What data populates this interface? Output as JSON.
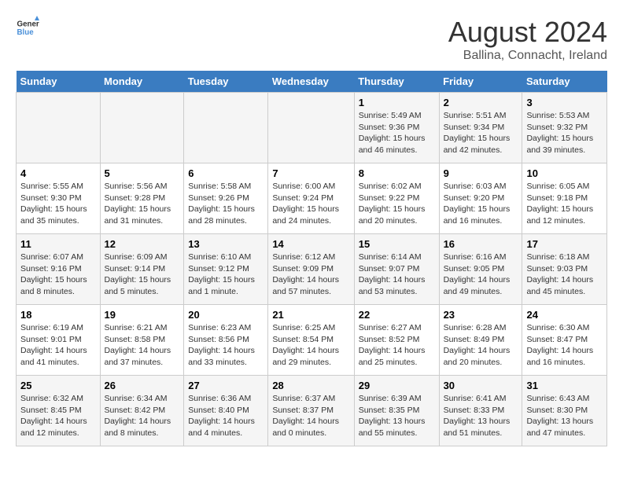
{
  "header": {
    "logo_general": "General",
    "logo_blue": "Blue",
    "title": "August 2024",
    "subtitle": "Ballina, Connacht, Ireland"
  },
  "calendar": {
    "days_of_week": [
      "Sunday",
      "Monday",
      "Tuesday",
      "Wednesday",
      "Thursday",
      "Friday",
      "Saturday"
    ],
    "weeks": [
      {
        "days": [
          {
            "number": "",
            "info": ""
          },
          {
            "number": "",
            "info": ""
          },
          {
            "number": "",
            "info": ""
          },
          {
            "number": "",
            "info": ""
          },
          {
            "number": "1",
            "info": "Sunrise: 5:49 AM\nSunset: 9:36 PM\nDaylight: 15 hours\nand 46 minutes."
          },
          {
            "number": "2",
            "info": "Sunrise: 5:51 AM\nSunset: 9:34 PM\nDaylight: 15 hours\nand 42 minutes."
          },
          {
            "number": "3",
            "info": "Sunrise: 5:53 AM\nSunset: 9:32 PM\nDaylight: 15 hours\nand 39 minutes."
          }
        ]
      },
      {
        "days": [
          {
            "number": "4",
            "info": "Sunrise: 5:55 AM\nSunset: 9:30 PM\nDaylight: 15 hours\nand 35 minutes."
          },
          {
            "number": "5",
            "info": "Sunrise: 5:56 AM\nSunset: 9:28 PM\nDaylight: 15 hours\nand 31 minutes."
          },
          {
            "number": "6",
            "info": "Sunrise: 5:58 AM\nSunset: 9:26 PM\nDaylight: 15 hours\nand 28 minutes."
          },
          {
            "number": "7",
            "info": "Sunrise: 6:00 AM\nSunset: 9:24 PM\nDaylight: 15 hours\nand 24 minutes."
          },
          {
            "number": "8",
            "info": "Sunrise: 6:02 AM\nSunset: 9:22 PM\nDaylight: 15 hours\nand 20 minutes."
          },
          {
            "number": "9",
            "info": "Sunrise: 6:03 AM\nSunset: 9:20 PM\nDaylight: 15 hours\nand 16 minutes."
          },
          {
            "number": "10",
            "info": "Sunrise: 6:05 AM\nSunset: 9:18 PM\nDaylight: 15 hours\nand 12 minutes."
          }
        ]
      },
      {
        "days": [
          {
            "number": "11",
            "info": "Sunrise: 6:07 AM\nSunset: 9:16 PM\nDaylight: 15 hours\nand 8 minutes."
          },
          {
            "number": "12",
            "info": "Sunrise: 6:09 AM\nSunset: 9:14 PM\nDaylight: 15 hours\nand 5 minutes."
          },
          {
            "number": "13",
            "info": "Sunrise: 6:10 AM\nSunset: 9:12 PM\nDaylight: 15 hours\nand 1 minute."
          },
          {
            "number": "14",
            "info": "Sunrise: 6:12 AM\nSunset: 9:09 PM\nDaylight: 14 hours\nand 57 minutes."
          },
          {
            "number": "15",
            "info": "Sunrise: 6:14 AM\nSunset: 9:07 PM\nDaylight: 14 hours\nand 53 minutes."
          },
          {
            "number": "16",
            "info": "Sunrise: 6:16 AM\nSunset: 9:05 PM\nDaylight: 14 hours\nand 49 minutes."
          },
          {
            "number": "17",
            "info": "Sunrise: 6:18 AM\nSunset: 9:03 PM\nDaylight: 14 hours\nand 45 minutes."
          }
        ]
      },
      {
        "days": [
          {
            "number": "18",
            "info": "Sunrise: 6:19 AM\nSunset: 9:01 PM\nDaylight: 14 hours\nand 41 minutes."
          },
          {
            "number": "19",
            "info": "Sunrise: 6:21 AM\nSunset: 8:58 PM\nDaylight: 14 hours\nand 37 minutes."
          },
          {
            "number": "20",
            "info": "Sunrise: 6:23 AM\nSunset: 8:56 PM\nDaylight: 14 hours\nand 33 minutes."
          },
          {
            "number": "21",
            "info": "Sunrise: 6:25 AM\nSunset: 8:54 PM\nDaylight: 14 hours\nand 29 minutes."
          },
          {
            "number": "22",
            "info": "Sunrise: 6:27 AM\nSunset: 8:52 PM\nDaylight: 14 hours\nand 25 minutes."
          },
          {
            "number": "23",
            "info": "Sunrise: 6:28 AM\nSunset: 8:49 PM\nDaylight: 14 hours\nand 20 minutes."
          },
          {
            "number": "24",
            "info": "Sunrise: 6:30 AM\nSunset: 8:47 PM\nDaylight: 14 hours\nand 16 minutes."
          }
        ]
      },
      {
        "days": [
          {
            "number": "25",
            "info": "Sunrise: 6:32 AM\nSunset: 8:45 PM\nDaylight: 14 hours\nand 12 minutes."
          },
          {
            "number": "26",
            "info": "Sunrise: 6:34 AM\nSunset: 8:42 PM\nDaylight: 14 hours\nand 8 minutes."
          },
          {
            "number": "27",
            "info": "Sunrise: 6:36 AM\nSunset: 8:40 PM\nDaylight: 14 hours\nand 4 minutes."
          },
          {
            "number": "28",
            "info": "Sunrise: 6:37 AM\nSunset: 8:37 PM\nDaylight: 14 hours\nand 0 minutes."
          },
          {
            "number": "29",
            "info": "Sunrise: 6:39 AM\nSunset: 8:35 PM\nDaylight: 13 hours\nand 55 minutes."
          },
          {
            "number": "30",
            "info": "Sunrise: 6:41 AM\nSunset: 8:33 PM\nDaylight: 13 hours\nand 51 minutes."
          },
          {
            "number": "31",
            "info": "Sunrise: 6:43 AM\nSunset: 8:30 PM\nDaylight: 13 hours\nand 47 minutes."
          }
        ]
      }
    ]
  }
}
